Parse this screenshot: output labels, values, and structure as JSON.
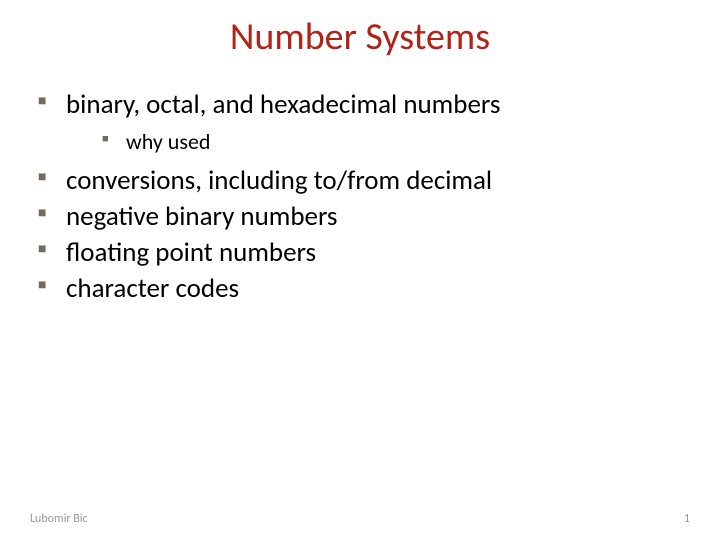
{
  "title": "Number Systems",
  "bullets": {
    "item0": "binary, octal, and hexadecimal numbers",
    "sub0": "why used",
    "item1": "conversions, including to/from decimal",
    "item2": "negative binary numbers",
    "item3": "floating point numbers",
    "item4": "character codes"
  },
  "footer": {
    "author": "Lubomir Bic",
    "page": "1"
  }
}
